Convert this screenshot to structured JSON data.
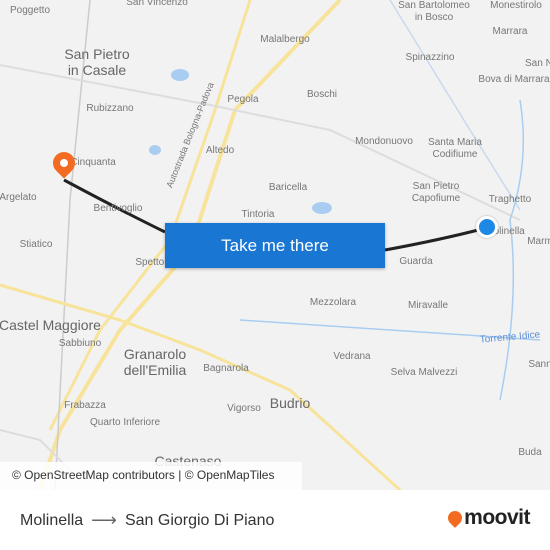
{
  "map": {
    "labels": [
      "Poggetto",
      "San Vincenzo",
      "San Bartolomeo\nin Bosco",
      "Monestirolo",
      "Malalbergo",
      "Marrara",
      "San Pietro\nin Casale",
      "Spinazzino",
      "San Ni",
      "Bova di Marrara",
      "Rubizzano",
      "Pegola",
      "Boschi",
      "Autostrada Bologna-Padova",
      "Mondonuovo",
      "Santa Maria\nCodifiume",
      "Cinquanta",
      "Altedo",
      "Baricella",
      "San Pietro\nCapofiume",
      "Traghetto",
      "Argelato",
      "Bentivoglio",
      "Tintoria",
      "Molinella",
      "Marm",
      "Stiatico",
      "Spettoli",
      "Guarda",
      "Mezzolara",
      "Miravalle",
      "Castel Maggiore",
      "Sabbiuno",
      "Granarolo\ndell'Emilia",
      "Torrente Idice",
      "Bagnarola",
      "Vedrana",
      "Selva Malvezzi",
      "Sann",
      "Frabazza",
      "Vigorso",
      "Budrio",
      "Quarto Inferiore",
      "Castenaso",
      "Buda"
    ],
    "origin_marker": "blue-dot",
    "destination_marker": "orange-pin",
    "route_color": "#222222",
    "water_color": "#a8cdf0",
    "highway_color": "#f7e39a"
  },
  "cta": {
    "label": "Take me there",
    "color": "#1976d2"
  },
  "attribution": "© OpenStreetMap contributors | © OpenMapTiles",
  "footer": {
    "origin": "Molinella",
    "arrow": "⟶",
    "destination": "San Giorgio Di Piano",
    "logo": "moovit",
    "logo_color": "#f26b21"
  }
}
